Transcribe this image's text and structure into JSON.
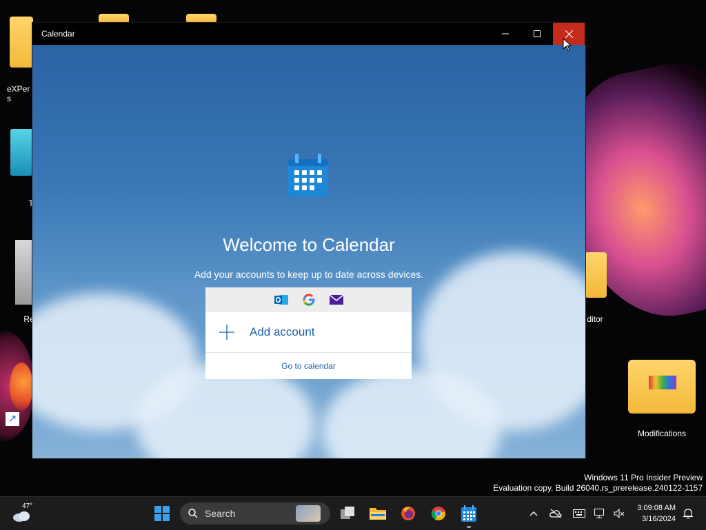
{
  "desktop": {
    "icons": [
      {
        "label": "eXPer\ns"
      },
      {
        "label": "T"
      },
      {
        "label": "Re"
      },
      {
        "label": "ditor"
      },
      {
        "label": "Modifications"
      }
    ]
  },
  "window": {
    "title": "Calendar",
    "controls": [
      "minimize",
      "maximize",
      "close"
    ]
  },
  "welcome": {
    "heading": "Welcome to Calendar",
    "subtitle": "Add your accounts to keep up to date across devices.",
    "providers": [
      "outlook-icon",
      "google-icon",
      "mail-icon"
    ],
    "add_account_label": "Add account",
    "go_to_calendar_label": "Go to calendar"
  },
  "watermark": {
    "line1": "Windows 11 Pro Insider Preview",
    "line2": "Evaluation copy. Build 26040.rs_prerelease.240122-1157"
  },
  "taskbar": {
    "weather_temp": "47°",
    "search_placeholder": "Search",
    "time": "3:09:08 AM",
    "date": "3/16/2024"
  },
  "colors": {
    "accent": "#1f5fa8",
    "close_hover": "#c42b1c",
    "taskbar": "#1c1c1c"
  }
}
